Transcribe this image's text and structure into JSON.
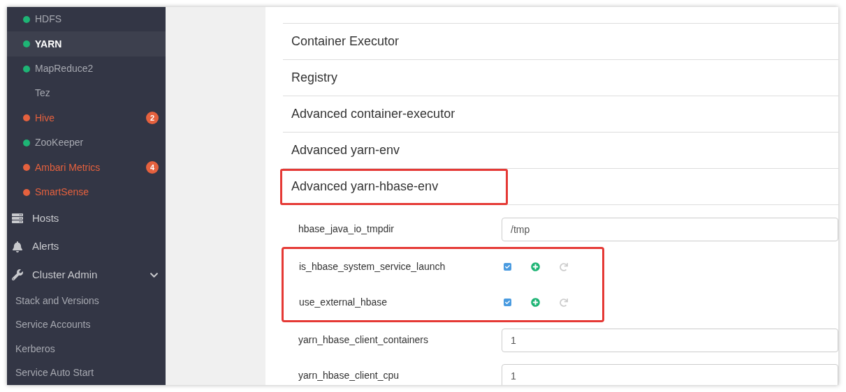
{
  "sidebar": {
    "services": [
      {
        "label": "HDFS",
        "color": "#1eb475",
        "alert": false,
        "selected": false
      },
      {
        "label": "YARN",
        "color": "#1eb475",
        "alert": false,
        "selected": true
      },
      {
        "label": "MapReduce2",
        "color": "#1eb475",
        "alert": false,
        "selected": false
      },
      {
        "label": "Tez",
        "alert": false,
        "selected": false
      },
      {
        "label": "Hive",
        "color": "#e5613e",
        "alert": true,
        "selected": false,
        "badge": "2"
      },
      {
        "label": "ZooKeeper",
        "color": "#1eb475",
        "alert": false,
        "selected": false
      },
      {
        "label": "Ambari Metrics",
        "color": "#e5613e",
        "alert": true,
        "selected": false,
        "badge": "4"
      },
      {
        "label": "SmartSense",
        "color": "#e5613e",
        "alert": true,
        "selected": false
      }
    ],
    "nav": [
      {
        "label": "Hosts",
        "kind": "hosts"
      },
      {
        "label": "Alerts",
        "kind": "alerts"
      },
      {
        "label": "Cluster Admin",
        "kind": "admin",
        "expanded": true
      }
    ],
    "admin_items": [
      "Stack and Versions",
      "Service Accounts",
      "Kerberos",
      "Service Auto Start"
    ]
  },
  "sections": [
    {
      "title": "Container Executor",
      "highlighted": false
    },
    {
      "title": "Registry",
      "highlighted": false
    },
    {
      "title": "Advanced container-executor",
      "highlighted": false
    },
    {
      "title": "Advanced yarn-env",
      "highlighted": false
    },
    {
      "title": "Advanced yarn-hbase-env",
      "highlighted": true
    }
  ],
  "properties": [
    {
      "name": "hbase_java_io_tmpdir",
      "kind": "text",
      "value": "/tmp",
      "highlighted": false
    },
    {
      "name": "is_hbase_system_service_launch",
      "kind": "checkbox",
      "checked": true,
      "highlighted": true
    },
    {
      "name": "use_external_hbase",
      "kind": "checkbox",
      "checked": true,
      "highlighted": true
    },
    {
      "name": "yarn_hbase_client_containers",
      "kind": "text",
      "value": "1",
      "highlighted": false
    },
    {
      "name": "yarn_hbase_client_cpu",
      "kind": "text",
      "value": "1",
      "highlighted": false
    }
  ]
}
